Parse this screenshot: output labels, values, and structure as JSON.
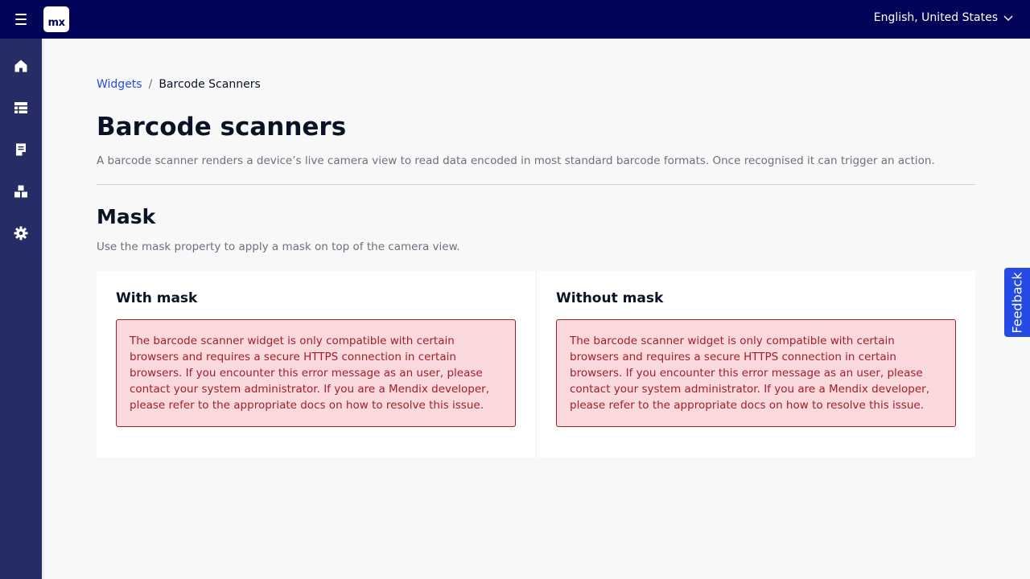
{
  "header": {
    "logo_text": "mx",
    "language": "English, United States",
    "background_color": "#020557"
  },
  "sidebar": {
    "background_color": "#252c66",
    "items": [
      {
        "icon": "home-icon"
      },
      {
        "icon": "table-icon"
      },
      {
        "icon": "page-icon"
      },
      {
        "icon": "blocks-icon"
      },
      {
        "icon": "gear-icon"
      }
    ]
  },
  "breadcrumb": {
    "parent": "Widgets",
    "separator": "/",
    "current": "Barcode Scanners"
  },
  "page": {
    "title": "Barcode scanners",
    "description": "A barcode scanner renders a device’s live camera view to read data encoded in most standard barcode formats. Once recognised it can trigger an action."
  },
  "section": {
    "title": "Mask",
    "description": "Use the mask property to apply a mask on top of the camera view."
  },
  "cards": [
    {
      "title": "With mask",
      "alert": "The barcode scanner widget is only compatible with certain browsers and requires a secure HTTPS connection in certain browsers. If you encounter this error message as an user, please contact your system administrator. If you are a Mendix developer, please refer to the appropriate docs on how to resolve this issue."
    },
    {
      "title": "Without mask",
      "alert": "The barcode scanner widget is only compatible with certain browsers and requires a secure HTTPS connection in certain browsers. If you encounter this error message as an user, please contact your system administrator. If you are a Mendix developer, please refer to the appropriate docs on how to resolve this issue."
    }
  ],
  "feedback": {
    "label": "Feedback",
    "color": "#264ae5"
  },
  "colors": {
    "link": "#264ae5",
    "alert_background": "#f9d9dc",
    "alert_text": "#a21e2d"
  }
}
